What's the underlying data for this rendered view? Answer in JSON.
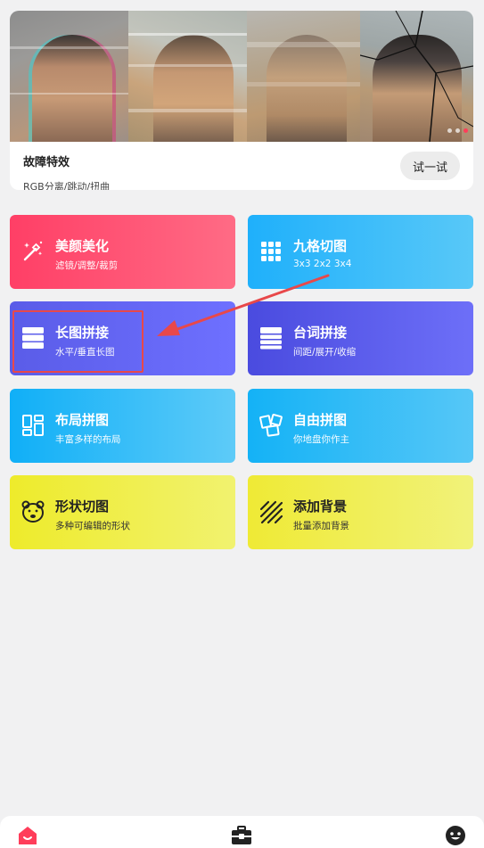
{
  "banner": {
    "title": "故障特效",
    "subtitle": "RGB分离/跳动/扭曲",
    "try_label": "试一试"
  },
  "tools": [
    {
      "id": "beauty",
      "title": "美颜美化",
      "subtitle": "滤镜/调整/裁剪",
      "icon": "magic-wand-icon"
    },
    {
      "id": "nine",
      "title": "九格切图",
      "subtitle": "3x3 2x2 3x4",
      "icon": "grid-icon"
    },
    {
      "id": "long",
      "title": "长图拼接",
      "subtitle": "水平/垂直长图",
      "icon": "stack-icon"
    },
    {
      "id": "lines",
      "title": "台词拼接",
      "subtitle": "间距/展开/收缩",
      "icon": "stack-icon"
    },
    {
      "id": "layout",
      "title": "布局拼图",
      "subtitle": "丰富多样的布局",
      "icon": "layout-icon"
    },
    {
      "id": "free",
      "title": "自由拼图",
      "subtitle": "你地盘你作主",
      "icon": "photos-icon"
    },
    {
      "id": "shape",
      "title": "形状切图",
      "subtitle": "多种可编辑的形状",
      "icon": "bear-icon"
    },
    {
      "id": "bg",
      "title": "添加背景",
      "subtitle": "批量添加背景",
      "icon": "stripes-icon"
    }
  ],
  "colors": {
    "accent": "#ff3d5a",
    "highlight": "#e8484a"
  },
  "nav": [
    "home-icon",
    "toolbox-icon",
    "smiley-icon"
  ]
}
